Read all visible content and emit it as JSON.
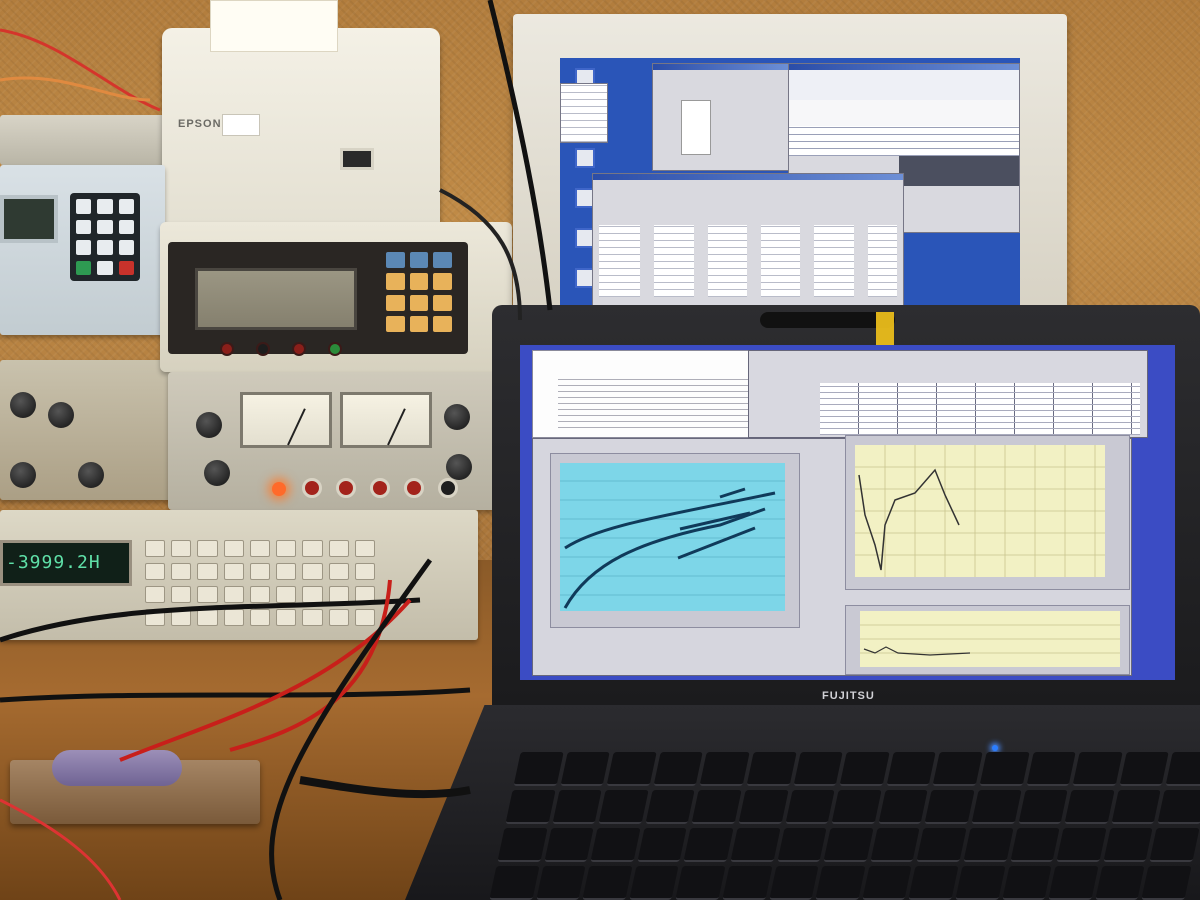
{
  "scene": {
    "printer_brand": "EPSON",
    "laptop_brand": "FUJITSU",
    "counter_readout": "-3999.2H"
  },
  "colors": {
    "wall": "#b27d3d",
    "desk": "#8a5a28",
    "laptop_screen": "#4e5ec8",
    "chart_cyan": "#7dd6e8",
    "chart_cream": "#f2f1c4",
    "tape_yellow": "#f0c11b"
  }
}
